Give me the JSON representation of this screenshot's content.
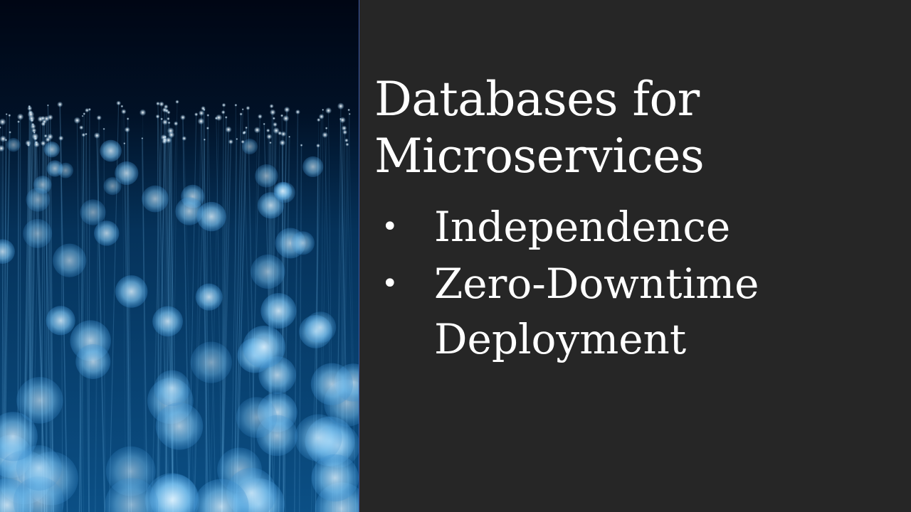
{
  "slide": {
    "title_lines": [
      "Databases for",
      "Microservices"
    ],
    "bullets": [
      {
        "marker": "•",
        "lines": [
          "Independence"
        ]
      },
      {
        "marker": "•",
        "lines": [
          "Zero-Downtime",
          "Deployment"
        ]
      }
    ]
  },
  "image": {
    "icon": "fiber-optic-bokeh-photo",
    "colors": {
      "background": "#00081a",
      "glow": "#4aa8e8",
      "highlight": "#e8f6ff"
    }
  },
  "colors": {
    "slide_background": "#262626",
    "text": "#ffffff",
    "divider": "#3d5aa8"
  }
}
